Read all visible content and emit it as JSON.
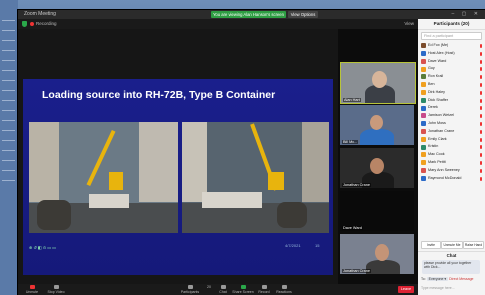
{
  "window": {
    "title": "Zoom Meeting",
    "share_banner": "You are viewing Alan Hanson's screen",
    "view_options": "View Options",
    "controls": "– ▢ ✕"
  },
  "meeting": {
    "recording_label": "Recording",
    "view_label": "View"
  },
  "slide": {
    "title": "Loading source into RH-72B, Type B Container",
    "footer_left": "⊕ ↺ ◧ ⊙ ▭ ▭",
    "date": "4/7/2021",
    "page": "15"
  },
  "videos": [
    {
      "name": "Alan Hart"
    },
    {
      "name": "Bill Mc..."
    },
    {
      "name": "Jonathan Crane"
    },
    {
      "name": "Dave Ward"
    },
    {
      "name": "Jonathan Crane"
    }
  ],
  "toolbar": {
    "audio": "Unmute",
    "video": "Stop Video",
    "participants": "Participants",
    "count": "20",
    "chat": "Chat",
    "share": "Share Screen",
    "record": "Record",
    "reactions": "Reactions",
    "end": "Leave"
  },
  "participants": {
    "header": "Participants (20)",
    "search_placeholder": "Find a participant",
    "list": [
      {
        "name": "Ed Fox (Me)",
        "color": "#7a4b2b",
        "mic": "#e33"
      },
      {
        "name": "Host Alex (Host)",
        "color": "#2b6ac8",
        "mic": "#e33"
      },
      {
        "name": "Dave Ward",
        "color": "#d9534f",
        "mic": "#e33"
      },
      {
        "name": "Guy",
        "color": "#f0a020",
        "mic": "#e33"
      },
      {
        "name": "Ron Krall",
        "color": "#5a7d3a",
        "mic": "#e33"
      },
      {
        "name": "Ben",
        "color": "#f0a020",
        "mic": "#e33"
      },
      {
        "name": "Dirk Haley",
        "color": "#f0a020",
        "mic": "#e33"
      },
      {
        "name": "Dick Shaffer",
        "color": "#2d8a6a",
        "mic": "#e33"
      },
      {
        "name": "Derek",
        "color": "#2b6ac8",
        "mic": "#e33"
      },
      {
        "name": "Jamison Wetzel",
        "color": "#c84a8a",
        "mic": "#e33"
      },
      {
        "name": "John Moss",
        "color": "#2b6ac8",
        "mic": "#e33"
      },
      {
        "name": "Jonathan Crane",
        "color": "#d9534f",
        "mic": "#e33"
      },
      {
        "name": "Emily Clark",
        "color": "#f0a020",
        "mic": "#e33"
      },
      {
        "name": "Kristin",
        "color": "#2d8a6a",
        "mic": "#e33"
      },
      {
        "name": "Mac Cook",
        "color": "#f0a020",
        "mic": "#e33"
      },
      {
        "name": "Mark Pettit",
        "color": "#f0a020",
        "mic": "#e33"
      },
      {
        "name": "Mary Ann Sweeney",
        "color": "#d9534f",
        "mic": "#e33"
      },
      {
        "name": "Raymond McDonald",
        "color": "#2b6ac8",
        "mic": "#e33"
      }
    ],
    "actions": {
      "invite": "Invite",
      "mute_all": "Unmute Me",
      "more": "Raise Hand"
    }
  },
  "chat": {
    "header": "Chat",
    "message": "please provide all your together with Dick...",
    "to_label": "To:",
    "to_value": "Everyone ▾",
    "warning": "Direct Message",
    "input_placeholder": "Type message here..."
  }
}
